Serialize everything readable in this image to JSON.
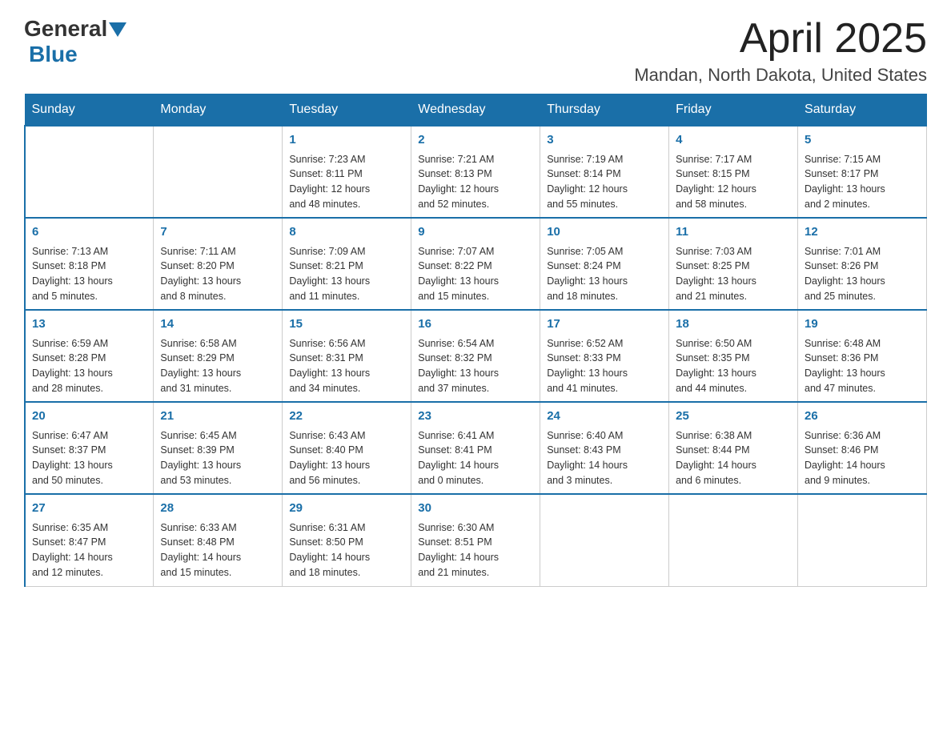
{
  "header": {
    "logo_general": "General",
    "logo_blue": "Blue",
    "title": "April 2025",
    "subtitle": "Mandan, North Dakota, United States"
  },
  "days_of_week": [
    "Sunday",
    "Monday",
    "Tuesday",
    "Wednesday",
    "Thursday",
    "Friday",
    "Saturday"
  ],
  "weeks": [
    [
      {
        "num": "",
        "info": ""
      },
      {
        "num": "",
        "info": ""
      },
      {
        "num": "1",
        "info": "Sunrise: 7:23 AM\nSunset: 8:11 PM\nDaylight: 12 hours\nand 48 minutes."
      },
      {
        "num": "2",
        "info": "Sunrise: 7:21 AM\nSunset: 8:13 PM\nDaylight: 12 hours\nand 52 minutes."
      },
      {
        "num": "3",
        "info": "Sunrise: 7:19 AM\nSunset: 8:14 PM\nDaylight: 12 hours\nand 55 minutes."
      },
      {
        "num": "4",
        "info": "Sunrise: 7:17 AM\nSunset: 8:15 PM\nDaylight: 12 hours\nand 58 minutes."
      },
      {
        "num": "5",
        "info": "Sunrise: 7:15 AM\nSunset: 8:17 PM\nDaylight: 13 hours\nand 2 minutes."
      }
    ],
    [
      {
        "num": "6",
        "info": "Sunrise: 7:13 AM\nSunset: 8:18 PM\nDaylight: 13 hours\nand 5 minutes."
      },
      {
        "num": "7",
        "info": "Sunrise: 7:11 AM\nSunset: 8:20 PM\nDaylight: 13 hours\nand 8 minutes."
      },
      {
        "num": "8",
        "info": "Sunrise: 7:09 AM\nSunset: 8:21 PM\nDaylight: 13 hours\nand 11 minutes."
      },
      {
        "num": "9",
        "info": "Sunrise: 7:07 AM\nSunset: 8:22 PM\nDaylight: 13 hours\nand 15 minutes."
      },
      {
        "num": "10",
        "info": "Sunrise: 7:05 AM\nSunset: 8:24 PM\nDaylight: 13 hours\nand 18 minutes."
      },
      {
        "num": "11",
        "info": "Sunrise: 7:03 AM\nSunset: 8:25 PM\nDaylight: 13 hours\nand 21 minutes."
      },
      {
        "num": "12",
        "info": "Sunrise: 7:01 AM\nSunset: 8:26 PM\nDaylight: 13 hours\nand 25 minutes."
      }
    ],
    [
      {
        "num": "13",
        "info": "Sunrise: 6:59 AM\nSunset: 8:28 PM\nDaylight: 13 hours\nand 28 minutes."
      },
      {
        "num": "14",
        "info": "Sunrise: 6:58 AM\nSunset: 8:29 PM\nDaylight: 13 hours\nand 31 minutes."
      },
      {
        "num": "15",
        "info": "Sunrise: 6:56 AM\nSunset: 8:31 PM\nDaylight: 13 hours\nand 34 minutes."
      },
      {
        "num": "16",
        "info": "Sunrise: 6:54 AM\nSunset: 8:32 PM\nDaylight: 13 hours\nand 37 minutes."
      },
      {
        "num": "17",
        "info": "Sunrise: 6:52 AM\nSunset: 8:33 PM\nDaylight: 13 hours\nand 41 minutes."
      },
      {
        "num": "18",
        "info": "Sunrise: 6:50 AM\nSunset: 8:35 PM\nDaylight: 13 hours\nand 44 minutes."
      },
      {
        "num": "19",
        "info": "Sunrise: 6:48 AM\nSunset: 8:36 PM\nDaylight: 13 hours\nand 47 minutes."
      }
    ],
    [
      {
        "num": "20",
        "info": "Sunrise: 6:47 AM\nSunset: 8:37 PM\nDaylight: 13 hours\nand 50 minutes."
      },
      {
        "num": "21",
        "info": "Sunrise: 6:45 AM\nSunset: 8:39 PM\nDaylight: 13 hours\nand 53 minutes."
      },
      {
        "num": "22",
        "info": "Sunrise: 6:43 AM\nSunset: 8:40 PM\nDaylight: 13 hours\nand 56 minutes."
      },
      {
        "num": "23",
        "info": "Sunrise: 6:41 AM\nSunset: 8:41 PM\nDaylight: 14 hours\nand 0 minutes."
      },
      {
        "num": "24",
        "info": "Sunrise: 6:40 AM\nSunset: 8:43 PM\nDaylight: 14 hours\nand 3 minutes."
      },
      {
        "num": "25",
        "info": "Sunrise: 6:38 AM\nSunset: 8:44 PM\nDaylight: 14 hours\nand 6 minutes."
      },
      {
        "num": "26",
        "info": "Sunrise: 6:36 AM\nSunset: 8:46 PM\nDaylight: 14 hours\nand 9 minutes."
      }
    ],
    [
      {
        "num": "27",
        "info": "Sunrise: 6:35 AM\nSunset: 8:47 PM\nDaylight: 14 hours\nand 12 minutes."
      },
      {
        "num": "28",
        "info": "Sunrise: 6:33 AM\nSunset: 8:48 PM\nDaylight: 14 hours\nand 15 minutes."
      },
      {
        "num": "29",
        "info": "Sunrise: 6:31 AM\nSunset: 8:50 PM\nDaylight: 14 hours\nand 18 minutes."
      },
      {
        "num": "30",
        "info": "Sunrise: 6:30 AM\nSunset: 8:51 PM\nDaylight: 14 hours\nand 21 minutes."
      },
      {
        "num": "",
        "info": ""
      },
      {
        "num": "",
        "info": ""
      },
      {
        "num": "",
        "info": ""
      }
    ]
  ]
}
